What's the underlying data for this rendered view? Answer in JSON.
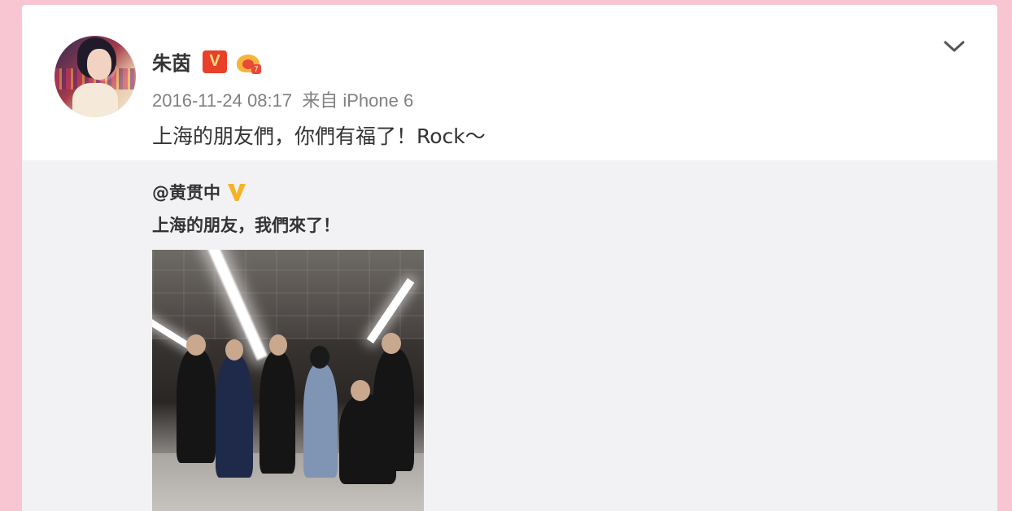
{
  "post": {
    "username": "朱茵",
    "verified_badge": "V",
    "level_badge": "7",
    "timestamp": "2016-11-24 08:17",
    "source_prefix": "来自",
    "source": "iPhone 6",
    "text": "上海的朋友們，你們有福了！Rock～"
  },
  "repost": {
    "author": "@黄贯中",
    "text": "上海的朋友，我們來了！"
  },
  "icons": {
    "menu": "chevron-down-icon",
    "verified": "verified-v-icon",
    "member": "crown-member-icon",
    "verified_yellow": "verified-yellow-v-icon"
  },
  "colors": {
    "background": "#f7c6d2",
    "card": "#ffffff",
    "repost_bg": "#f2f2f5",
    "text": "#333333",
    "meta": "#808080",
    "verified_red": "#e8402a",
    "verified_yellow": "#f5b325"
  }
}
